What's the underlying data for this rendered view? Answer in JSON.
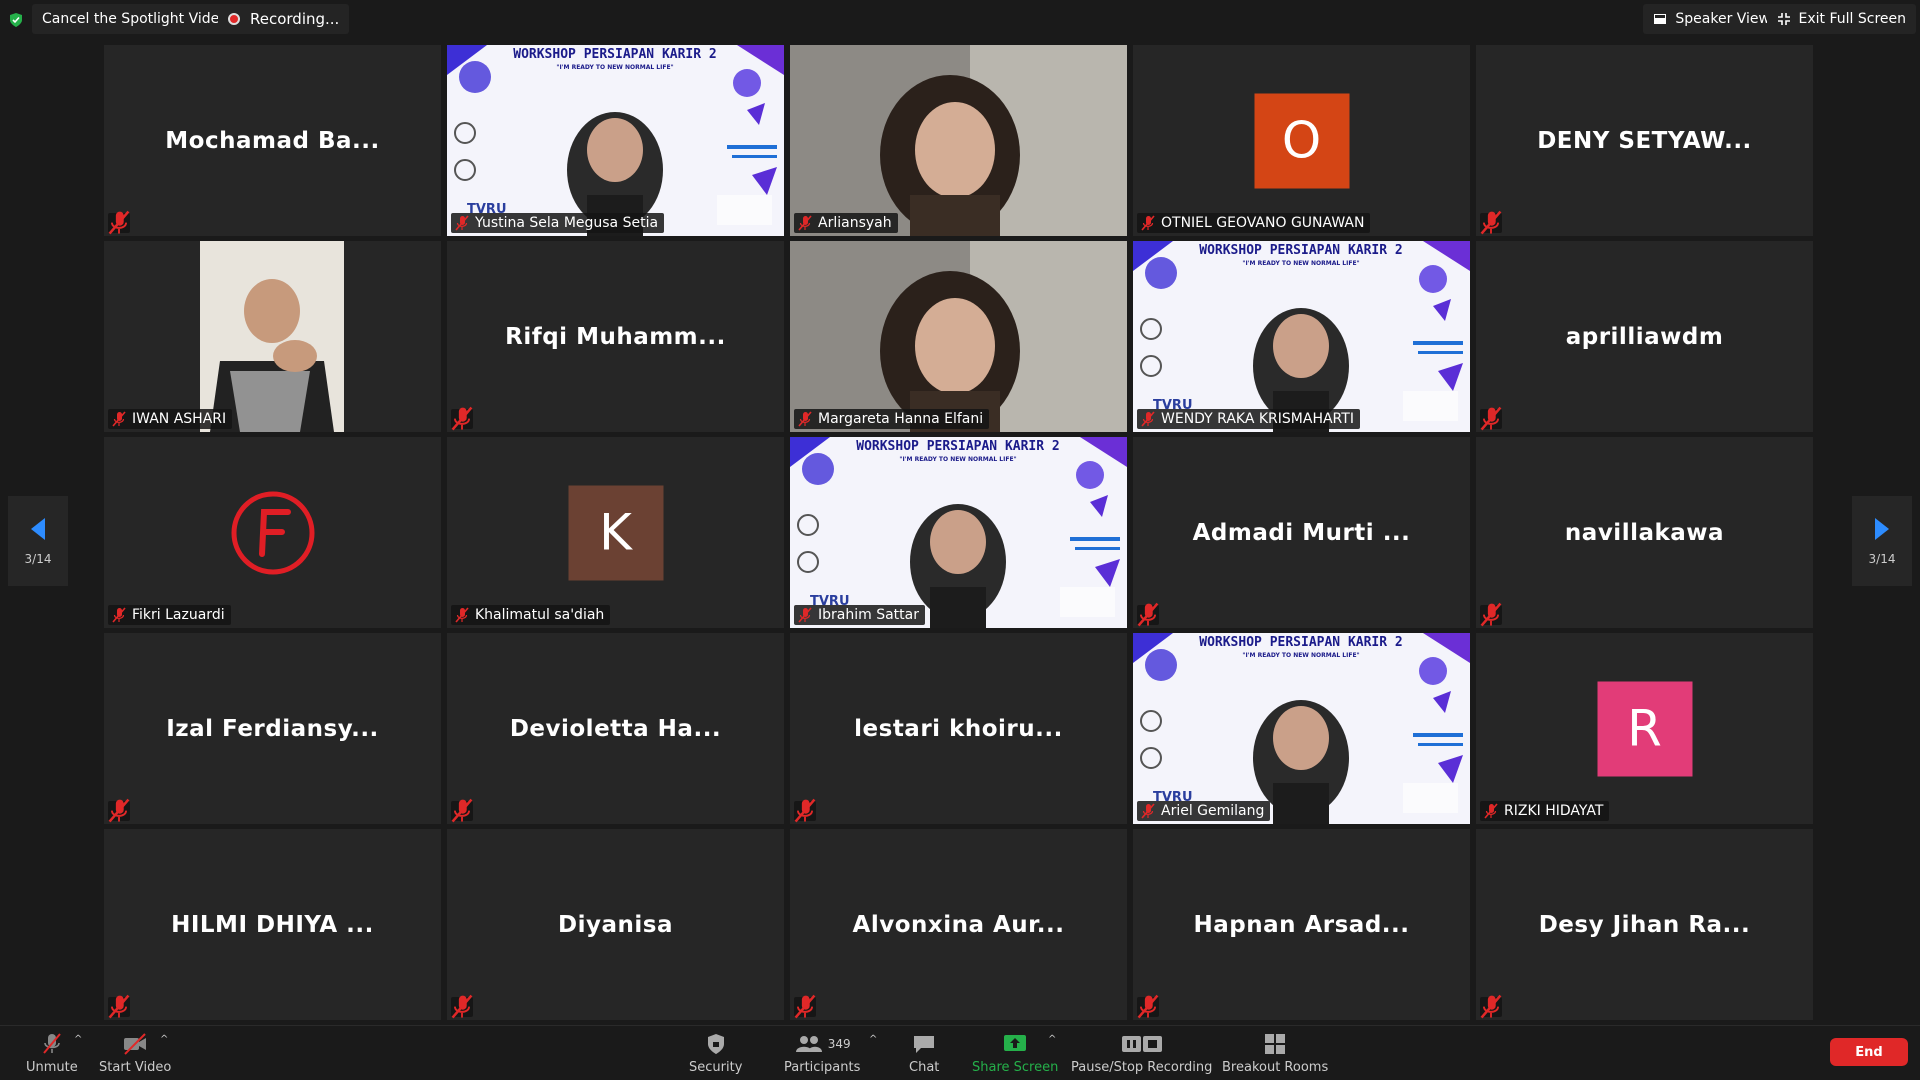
{
  "topbar": {
    "cancel_spotlight": "Cancel the Spotlight Video",
    "recording": "Recording...",
    "speaker_view": "Speaker View",
    "exit_full_screen": "Exit Full Screen"
  },
  "pager": {
    "left": "3/14",
    "right": "3/14"
  },
  "tiles": [
    {
      "display": "Mochamad Ba...",
      "tag": ""
    },
    {
      "display": "",
      "tag": "Yustina Sela Megusa Setia",
      "video": "workshop"
    },
    {
      "display": "",
      "tag": "Arliansyah",
      "video": "cam"
    },
    {
      "display": "",
      "tag": "OTNIEL GEOVANO GUNAWAN",
      "avatar": "O",
      "avatar_color": "#d44515"
    },
    {
      "display": "DENY SETYAW...",
      "tag": ""
    },
    {
      "display": "",
      "tag": "IWAN ASHARI",
      "video": "cam-narrow"
    },
    {
      "display": "Rifqi Muhamm...",
      "tag": ""
    },
    {
      "display": "",
      "tag": "Margareta Hanna Elfani",
      "video": "cam"
    },
    {
      "display": "",
      "tag": "WENDY RAKA KRISMAHARTI",
      "video": "workshop"
    },
    {
      "display": "aprilliawdm",
      "tag": ""
    },
    {
      "display": "",
      "tag": "Fikri Lazuardi",
      "avatar": "F-logo"
    },
    {
      "display": "",
      "tag": "Khalimatul sa'diah",
      "avatar": "K",
      "avatar_color": "#6b4133"
    },
    {
      "display": "",
      "tag": "Ibrahim Sattar",
      "video": "workshop"
    },
    {
      "display": "Admadi Murti ...",
      "tag": ""
    },
    {
      "display": "navillakawa",
      "tag": ""
    },
    {
      "display": "Izal Ferdiansy...",
      "tag": ""
    },
    {
      "display": "Devioletta Ha...",
      "tag": ""
    },
    {
      "display": "lestari khoiru...",
      "tag": ""
    },
    {
      "display": "",
      "tag": "Ariel Gemilang",
      "video": "workshop"
    },
    {
      "display": "",
      "tag": "RIZKI HIDAYAT",
      "avatar": "R",
      "avatar_color": "#e23c78"
    },
    {
      "display": "HILMI DHIYA ...",
      "tag": ""
    },
    {
      "display": "Diyanisa",
      "tag": ""
    },
    {
      "display": "Alvonxina Aur...",
      "tag": ""
    },
    {
      "display": "Hapnan Arsad...",
      "tag": ""
    },
    {
      "display": "Desy Jihan Ra...",
      "tag": ""
    }
  ],
  "workshop_banner": {
    "title": "WORKSHOP PERSIAPAN KARIR 2",
    "subtitle": "\"I'M READY TO NEW NORMAL LIFE\""
  },
  "toolbar": {
    "unmute": "Unmute",
    "start_video": "Start Video",
    "security": "Security",
    "participants": "Participants",
    "participants_count": "349",
    "chat": "Chat",
    "share_screen": "Share Screen",
    "pause_stop_recording": "Pause/Stop Recording",
    "breakout_rooms": "Breakout Rooms",
    "end": "End"
  },
  "colors": {
    "accent_green": "#25b04a",
    "end_red": "#e02828",
    "nav_blue": "#2d8cff",
    "mute_red": "#e02828"
  }
}
